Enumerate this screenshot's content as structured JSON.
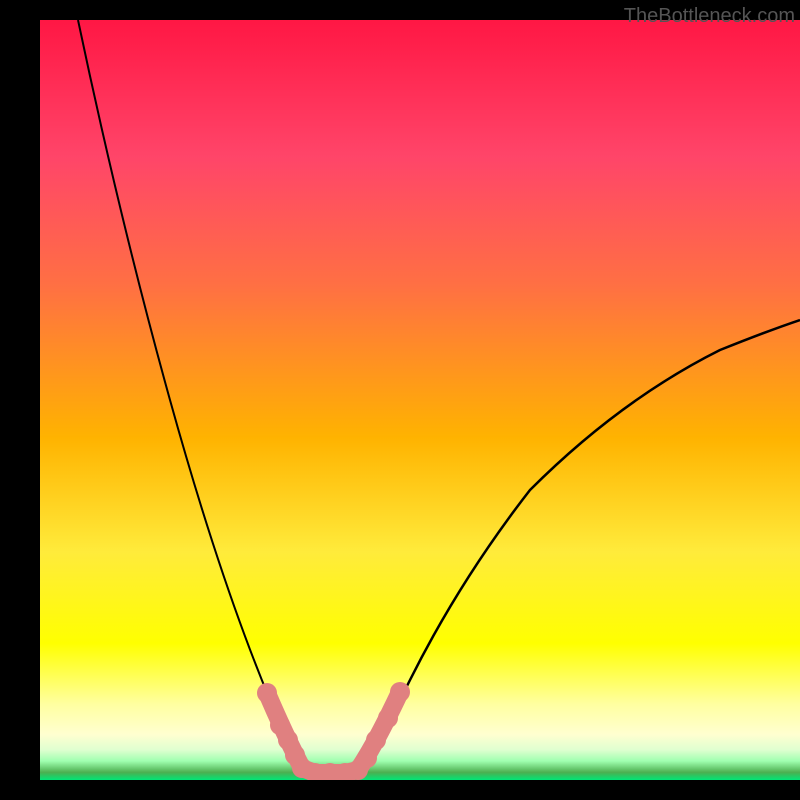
{
  "watermark": "TheBottleneck.com",
  "chart_data": {
    "type": "line",
    "title": "",
    "xlabel": "",
    "ylabel": "",
    "xlim": [
      0,
      100
    ],
    "ylim": [
      0,
      100
    ],
    "gradient_colors": {
      "top": "#ff1744",
      "upper_mid": "#ff7043",
      "mid": "#ffeb3b",
      "lower_mid": "#ffff8d",
      "bottom": "#00e676"
    },
    "series": [
      {
        "name": "left-curve",
        "type": "line",
        "x": [
          5,
          8,
          12,
          16,
          20,
          24,
          28,
          31,
          33,
          35
        ],
        "y": [
          100,
          85,
          68,
          52,
          38,
          26,
          16,
          8,
          4,
          1
        ],
        "color": "#000000",
        "width": 2
      },
      {
        "name": "right-curve",
        "type": "line",
        "x": [
          42,
          45,
          50,
          56,
          63,
          71,
          80,
          90,
          100
        ],
        "y": [
          1,
          5,
          12,
          22,
          33,
          42,
          50,
          56,
          60
        ],
        "color": "#000000",
        "width": 2
      },
      {
        "name": "bottom-overlay-markers",
        "type": "scatter",
        "x": [
          30,
          32,
          33,
          34,
          35,
          37,
          39,
          41,
          42,
          43,
          44,
          46,
          48
        ],
        "y": [
          11,
          7,
          5,
          3,
          1,
          0,
          0,
          0,
          1,
          3,
          5,
          8,
          12
        ],
        "color": "#e57373",
        "marker_size": 12
      }
    ]
  }
}
